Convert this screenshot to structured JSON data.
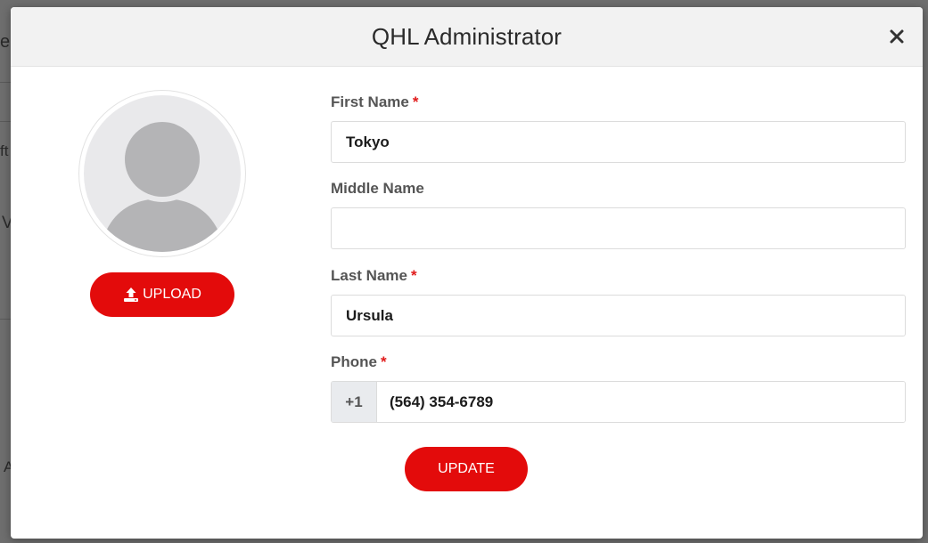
{
  "modal": {
    "title": "QHL Administrator",
    "close_icon": "close-icon"
  },
  "avatar": {
    "icon": "person-silhouette-icon",
    "upload_icon": "upload-icon",
    "upload_label": "UPLOAD"
  },
  "form": {
    "first_name": {
      "label": "First Name",
      "required_mark": "*",
      "value": "Tokyo",
      "placeholder": ""
    },
    "middle_name": {
      "label": "Middle Name",
      "value": "",
      "placeholder": ""
    },
    "last_name": {
      "label": "Last Name",
      "required_mark": "*",
      "value": "Ursula",
      "placeholder": ""
    },
    "phone": {
      "label": "Phone",
      "required_mark": "*",
      "country_code": "+1",
      "value": "(564) 354-6789"
    },
    "update_label": "UPDATE"
  },
  "background_fragments": {
    "frag1": "e",
    "frag2": "ft",
    "frag3": "V",
    "frag4": "A"
  },
  "colors": {
    "accent": "#e30b0b",
    "required": "#e01b1b",
    "header_bg": "#f2f2f2",
    "overlay": "#6e6e6e"
  }
}
